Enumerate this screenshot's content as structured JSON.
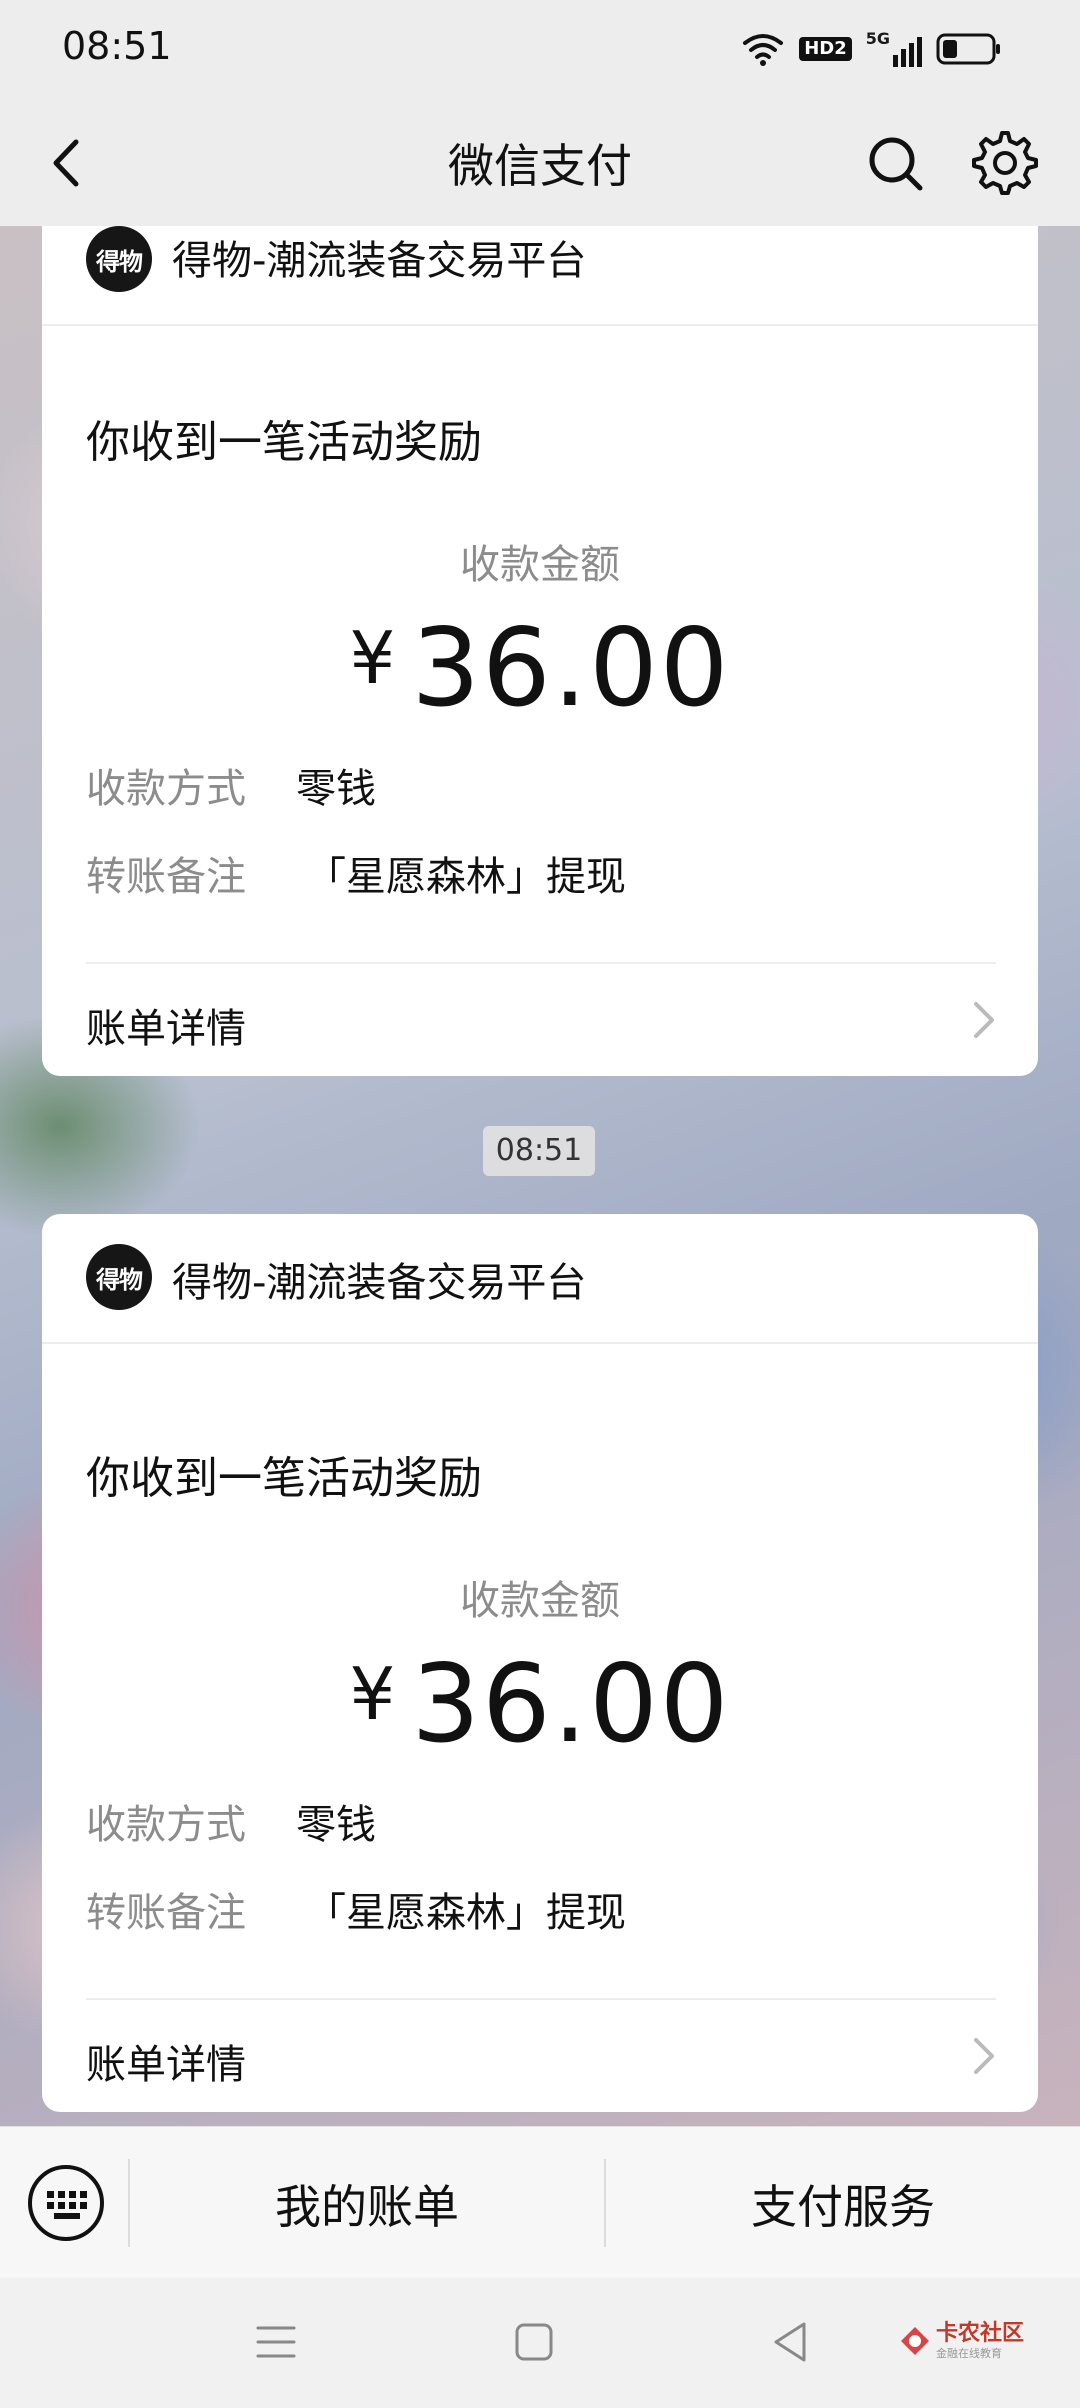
{
  "status_bar": {
    "time": "08:51",
    "icons": [
      "wifi-icon",
      "hd-icon",
      "5g-signal-icon",
      "battery-icon"
    ],
    "hd_label": "HD2",
    "net_label": "5G"
  },
  "nav": {
    "title": "微信支付",
    "icons": [
      "back-icon",
      "search-icon",
      "settings-icon"
    ]
  },
  "messages": [
    {
      "merchant": "得物-潮流装备交易平台",
      "merchant_logo_text": "得物",
      "title": "你收到一笔活动奖励",
      "amount_label": "收款金额",
      "currency": "¥",
      "amount": "36.00",
      "method_label": "收款方式",
      "method_value": "零钱",
      "note_label": "转账备注",
      "note_value": "「星愿森林」提现",
      "bill_link": "账单详情"
    },
    {
      "merchant": "得物-潮流装备交易平台",
      "merchant_logo_text": "得物",
      "title": "你收到一笔活动奖励",
      "amount_label": "收款金额",
      "currency": "¥",
      "amount": "36.00",
      "method_label": "收款方式",
      "method_value": "零钱",
      "note_label": "转账备注",
      "note_value": "「星愿森林」提现",
      "bill_link": "账单详情"
    }
  ],
  "timestamp": "08:51",
  "bottom_menu": {
    "items": [
      "我的账单",
      "支付服务"
    ],
    "keyboard_icon": "keyboard-icon"
  },
  "system_nav": {
    "icons": [
      "menu-icon",
      "home-icon",
      "back-triangle-icon"
    ],
    "watermark": "卡农社区",
    "watermark_sub": "金融在线教育"
  },
  "colors": {
    "background": "#ededed",
    "card": "#ffffff",
    "label_gray": "#8c8c8c",
    "text": "#111111"
  }
}
